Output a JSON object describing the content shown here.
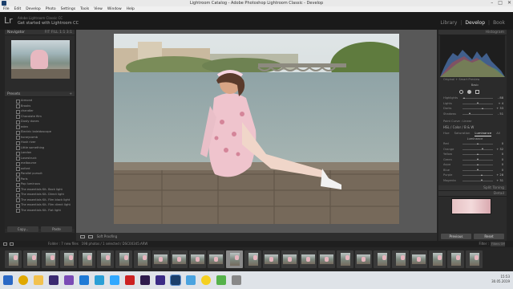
{
  "window": {
    "title": "Lightroom Catalog - Adobe Photoshop Lightroom Classic - Develop"
  },
  "menu": [
    "File",
    "Edit",
    "Develop",
    "Photo",
    "Settings",
    "Tools",
    "View",
    "Window",
    "Help"
  ],
  "identity": {
    "logo": "Lr",
    "line1": "Adobe Lightroom Classic CC",
    "line2": "Get started with Lightroom CC"
  },
  "modules": {
    "library": "Library",
    "develop": "Develop",
    "book": "Book",
    "sep": "|"
  },
  "left_panel": {
    "navigator": "Navigator",
    "navigator_zoom": "FIT  FILL  1:1  3:1",
    "presets": "Presets",
    "preset_items": [
      "Armond",
      "Brooks",
      "chandler",
      "Chocolate film",
      "Dusty dunes",
      "eden",
      "Electric kaleidoscope",
      "honeycomb",
      "Hush river",
      "Little something",
      "London",
      "Lovestruck",
      "melbourne",
      "oxford",
      "Parallel pursuit",
      "Paris",
      "Pop luminous",
      "The essentials Kit- Back light",
      "The essentials Kit- Direct light",
      "The essentials Kit- Film black light",
      "The essentials Kit- Film direct light",
      "The essentials Kit- Flat light"
    ],
    "copy_btn": "Copy...",
    "paste_btn": "Paste"
  },
  "toolbar": {
    "soft_proofing": "Soft Proofing"
  },
  "right_panel": {
    "histogram": "Histogram",
    "original_photo": "Original + Smart Preview",
    "wb_title": "Basic",
    "basic_rows": [
      {
        "label": "Highlights",
        "value": "- 88"
      },
      {
        "label": "Lights",
        "value": "+ 4"
      },
      {
        "label": "Darks",
        "value": "+ 33"
      },
      {
        "label": "Shadows",
        "value": "- 51"
      }
    ],
    "point_curve": "Point Curve : Linear",
    "hsl_head": "HSL / Color / B & W",
    "tabs": {
      "hue": "Hue",
      "saturation": "Saturation",
      "luminance": "Luminance",
      "all": "All"
    },
    "luminance_title": "Luminance",
    "lum_rows": [
      {
        "label": "Red",
        "value": "0"
      },
      {
        "label": "Orange",
        "value": "+ 32"
      },
      {
        "label": "Yellow",
        "value": "0"
      },
      {
        "label": "Green",
        "value": "0"
      },
      {
        "label": "Aqua",
        "value": "0"
      },
      {
        "label": "Blue",
        "value": "0"
      },
      {
        "label": "Purple",
        "value": "+ 28"
      },
      {
        "label": "Magenta",
        "value": "+ 31"
      }
    ],
    "split_toning": "Split Toning",
    "detail": "Detail",
    "previous_btn": "Previous",
    "reset_btn": "Reset"
  },
  "filmstrip": {
    "folder": "Folder : 7 new files",
    "status": "198 photos / 1 selected / DSC00345.ARW",
    "filter_label": "Filter :",
    "filter_value": "Filters Off"
  },
  "tray": {
    "time": "15:53",
    "date": "30.05.2019"
  }
}
